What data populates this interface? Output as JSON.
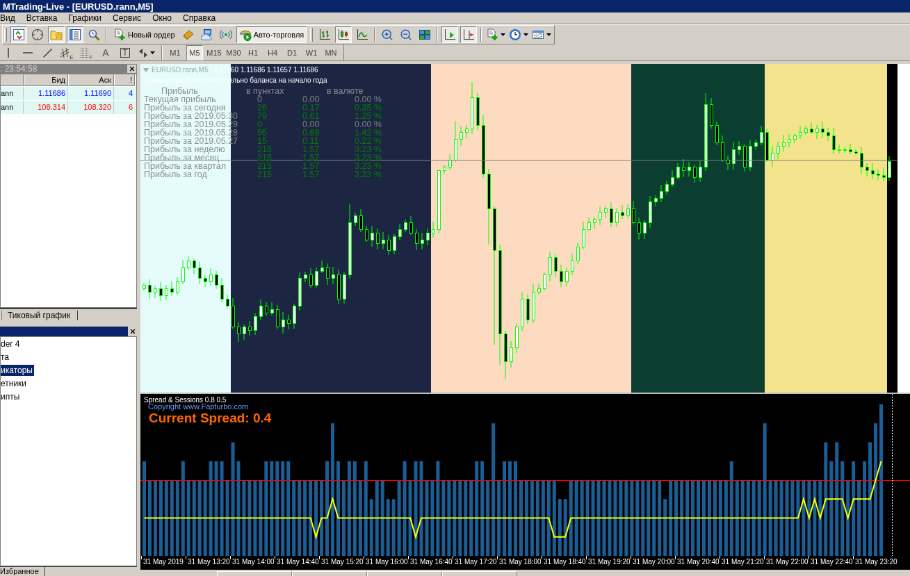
{
  "window": {
    "title": "MTrading-Live - [EURUSD.rann,M5]"
  },
  "menu": [
    "Вид",
    "Вставка",
    "Графики",
    "Сервис",
    "Окно",
    "Справка"
  ],
  "toolbar": [
    {
      "pressed": true
    },
    {
      "pressed": false
    },
    {
      "pressed": true
    },
    {
      "pressed": true
    },
    {
      "pressed": false
    },
    {
      "label": "Новый ордер",
      "pressed": false
    },
    {
      "pressed": false
    },
    {
      "pressed": false
    },
    {
      "pressed": false
    },
    {
      "label": "Авто-торговля",
      "pressed": true
    },
    {
      "pressed": false
    },
    {
      "pressed": true
    },
    {
      "pressed": false
    },
    {
      "pressed": false
    },
    {
      "pressed": false
    },
    {
      "pressed": false
    },
    {
      "pressed": true
    },
    {
      "pressed": true
    },
    {
      "pressed": false
    },
    {
      "pressed": false
    },
    {
      "pressed": false
    }
  ],
  "drawing_tools": [
    {
      "pressed": false
    },
    {
      "pressed": false
    },
    {
      "pressed": false
    },
    {
      "letter": "E",
      "pressed": false
    },
    {
      "letter": "F",
      "pressed": false
    },
    {
      "label": "A",
      "pressed": false
    },
    {
      "label": "T",
      "pressed": false
    },
    {
      "pressed": false
    }
  ],
  "timeframes": [
    {
      "label": "M1",
      "selected": false
    },
    {
      "label": "M5",
      "selected": true
    },
    {
      "label": "M15",
      "selected": false
    },
    {
      "label": "M30",
      "selected": false
    },
    {
      "label": "H1",
      "selected": false
    },
    {
      "label": "H4",
      "selected": false
    },
    {
      "label": "D1",
      "selected": false
    },
    {
      "label": "W1",
      "selected": false
    },
    {
      "label": "MN",
      "selected": false
    }
  ],
  "market_watch": {
    "title": ": 23:54:58",
    "columns": [
      "Бид",
      "Аск",
      "!"
    ],
    "rows": [
      {
        "symbol": "ann",
        "bid": "1.11686",
        "ask": "1.11690",
        "spread": "4",
        "color": "#0000ff"
      },
      {
        "symbol": "ann",
        "bid": "108.314",
        "ask": "108.320",
        "spread": "6",
        "color": "#ff0000"
      }
    ],
    "tabs": [
      "Тиковый график"
    ]
  },
  "navigator": {
    "items": [
      {
        "label": "der 4",
        "selected": false
      },
      {
        "label": "та",
        "selected": false
      },
      {
        "label": "икаторы",
        "selected": true
      },
      {
        "label": "етники",
        "selected": false
      },
      {
        "label": "ипты",
        "selected": false
      }
    ],
    "tabs": [
      "Избранное"
    ]
  },
  "chart": {
    "symbol": "EURUSD.rann,M5",
    "prices": "1.11660 1.11686 1.11657 1.11686",
    "note": "Процент прибыли относительно баланса на начало года",
    "profit_table": {
      "columns": [
        "Прибыль",
        "в пунктах",
        "в валюте"
      ],
      "rows": [
        {
          "label": "Текущая прибыль",
          "values": [
            {
              "text": "0",
              "color": "#808080"
            },
            {
              "text": "0.00",
              "color": "#808080"
            },
            {
              "text": "0.00 %",
              "color": "#808080"
            }
          ]
        },
        {
          "label": "Прибыль за сегодня",
          "values": [
            {
              "text": "26",
              "color": "#008000"
            },
            {
              "text": "0.17",
              "color": "#008000"
            },
            {
              "text": "0.35 %",
              "color": "#008000"
            }
          ]
        },
        {
          "label": "Прибыль за 2019.05.30",
          "values": [
            {
              "text": "79",
              "color": "#008000"
            },
            {
              "text": "0.61",
              "color": "#008000"
            },
            {
              "text": "1.25 %",
              "color": "#008000"
            }
          ]
        },
        {
          "label": "Прибыль за 2019.05.29",
          "values": [
            {
              "text": "0",
              "color": "#008000"
            },
            {
              "text": "0.00",
              "color": "#808080"
            },
            {
              "text": "0.00 %",
              "color": "#808080"
            }
          ]
        },
        {
          "label": "Прибыль за 2019.05.28",
          "values": [
            {
              "text": "95",
              "color": "#008000"
            },
            {
              "text": "0.69",
              "color": "#008000"
            },
            {
              "text": "1.42 %",
              "color": "#008000"
            }
          ]
        },
        {
          "label": "Прибыль за 2019.05.27",
          "values": [
            {
              "text": "15",
              "color": "#008000"
            },
            {
              "text": "0.11",
              "color": "#008000"
            },
            {
              "text": "0.22 %",
              "color": "#008000"
            }
          ]
        },
        {
          "label": "Прибыль за неделю",
          "values": [
            {
              "text": "215",
              "color": "#008000"
            },
            {
              "text": "1.57",
              "color": "#008000"
            },
            {
              "text": "3.23 %",
              "color": "#008000"
            }
          ]
        },
        {
          "label": "Прибыль за месяц",
          "values": [
            {
              "text": "215",
              "color": "#008000"
            },
            {
              "text": "1.57",
              "color": "#008000"
            },
            {
              "text": "3.23 %",
              "color": "#008000"
            }
          ]
        },
        {
          "label": "Прибыль за квартал",
          "values": [
            {
              "text": "215",
              "color": "#008000"
            },
            {
              "text": "1.57",
              "color": "#008000"
            },
            {
              "text": "3.23 %",
              "color": "#008000"
            }
          ]
        },
        {
          "label": "Прибыль за год",
          "values": [
            {
              "text": "215",
              "color": "#008000"
            },
            {
              "text": "1.57",
              "color": "#008000"
            },
            {
              "text": "3.23 %",
              "color": "#008000"
            }
          ]
        }
      ]
    }
  },
  "indicator": {
    "title": "Spread & Sessions 0.8 0.5",
    "copyright": "Copyright www.Fapturbo.com",
    "current_spread": "Current Spread: 0.4",
    "time_axis": [
      "31 May 2019",
      "31 May 13:20",
      "31 May 14:00",
      "31 May 14:40",
      "31 May 15:20",
      "31 May 16:00",
      "31 May 16:40",
      "31 May 17:20",
      "31 May 18:00",
      "31 May 18:40",
      "31 May 19:20",
      "31 May 20:00",
      "31 May 20:40",
      "31 May 21:20",
      "31 May 22:00",
      "31 May 22:40",
      "31 May 23:20"
    ]
  }
}
